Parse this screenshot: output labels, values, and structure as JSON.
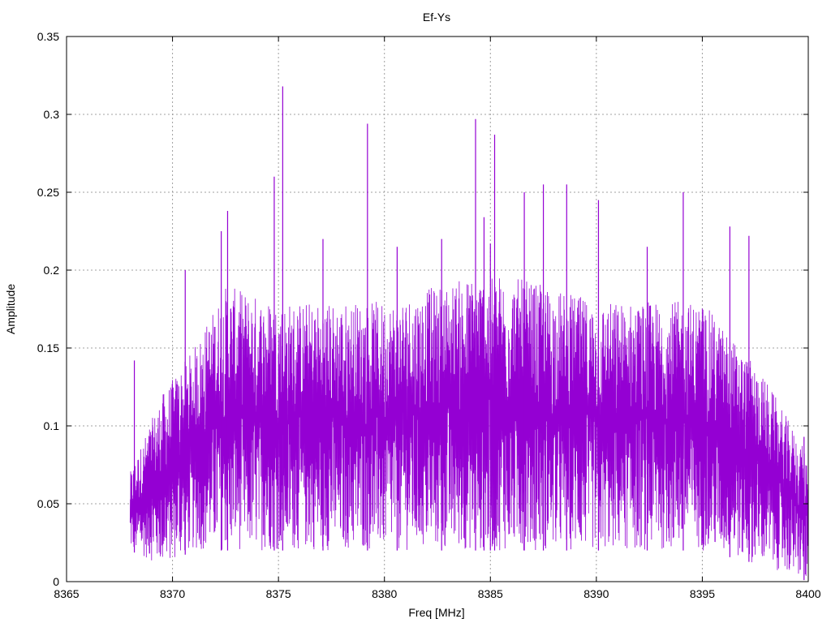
{
  "chart_data": {
    "type": "line",
    "title": "Ef-Ys",
    "xlabel": "Freq [MHz]",
    "ylabel": "Amplitude",
    "xlim": [
      8365,
      8400
    ],
    "ylim": [
      0,
      0.35
    ],
    "x_ticks": [
      "8365",
      "8370",
      "8375",
      "8380",
      "8385",
      "8390",
      "8395",
      "8400"
    ],
    "y_ticks": [
      "0",
      "0.05",
      "0.1",
      "0.15",
      "0.2",
      "0.25",
      "0.3",
      "0.35"
    ],
    "grid": true,
    "line_color": "#9400d3",
    "series": [
      {
        "x_range": [
          8368,
          8400
        ],
        "envelope": [
          {
            "x": 8368.0,
            "low": 0.02,
            "high": 0.07
          },
          {
            "x": 8369.5,
            "low": 0.01,
            "high": 0.12
          },
          {
            "x": 8371.0,
            "low": 0.02,
            "high": 0.15
          },
          {
            "x": 8372.5,
            "low": 0.02,
            "high": 0.19
          },
          {
            "x": 8375.0,
            "low": 0.02,
            "high": 0.18
          },
          {
            "x": 8380.0,
            "low": 0.02,
            "high": 0.18
          },
          {
            "x": 8385.0,
            "low": 0.02,
            "high": 0.2
          },
          {
            "x": 8390.0,
            "low": 0.02,
            "high": 0.18
          },
          {
            "x": 8395.0,
            "low": 0.02,
            "high": 0.18
          },
          {
            "x": 8398.0,
            "low": 0.01,
            "high": 0.13
          },
          {
            "x": 8400.0,
            "low": 0.0,
            "high": 0.08
          }
        ],
        "peaks": [
          {
            "x": 8375.2,
            "y": 0.318
          },
          {
            "x": 8384.3,
            "y": 0.297
          },
          {
            "x": 8379.2,
            "y": 0.294
          },
          {
            "x": 8385.2,
            "y": 0.287
          },
          {
            "x": 8374.8,
            "y": 0.26
          },
          {
            "x": 8387.5,
            "y": 0.255
          },
          {
            "x": 8388.6,
            "y": 0.255
          },
          {
            "x": 8394.1,
            "y": 0.25
          },
          {
            "x": 8386.6,
            "y": 0.25
          },
          {
            "x": 8390.1,
            "y": 0.245
          },
          {
            "x": 8372.6,
            "y": 0.238
          },
          {
            "x": 8384.7,
            "y": 0.234
          },
          {
            "x": 8396.3,
            "y": 0.228
          },
          {
            "x": 8372.3,
            "y": 0.225
          },
          {
            "x": 8397.2,
            "y": 0.222
          },
          {
            "x": 8377.1,
            "y": 0.22
          },
          {
            "x": 8382.7,
            "y": 0.22
          },
          {
            "x": 8385.0,
            "y": 0.217
          },
          {
            "x": 8380.6,
            "y": 0.215
          },
          {
            "x": 8392.4,
            "y": 0.215
          },
          {
            "x": 8370.6,
            "y": 0.2
          },
          {
            "x": 8368.2,
            "y": 0.142
          },
          {
            "x": 8399.8,
            "y": 0.093
          }
        ]
      }
    ]
  }
}
